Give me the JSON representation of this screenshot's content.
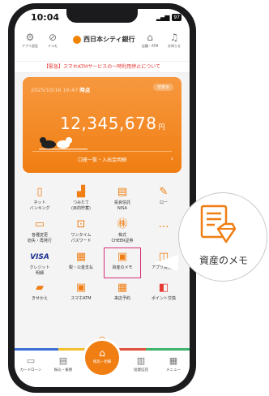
{
  "status": {
    "time": "10:04",
    "battery": "97"
  },
  "header": {
    "left_buttons": [
      {
        "icon": "gear-icon",
        "label": "アプリ設定"
      },
      {
        "icon": "link-icon",
        "label": "ドコモ"
      }
    ],
    "brand": "西日本シティ銀行",
    "right_buttons": [
      {
        "icon": "atm-icon",
        "label": "店舗・ATM"
      },
      {
        "icon": "bell-icon",
        "label": "お知らせ"
      }
    ]
  },
  "alert": "【緊急】スマホATMサービスの一時利用停止について",
  "account": {
    "date": "2025/10/16 16:47",
    "date_suffix": "時点",
    "badge": "非表示",
    "balance": "12,345,678",
    "currency": "円",
    "link": "口座一覧・入出金明細"
  },
  "menu": [
    {
      "icon": "phone-icon",
      "label": "ネット\nバンキング"
    },
    {
      "icon": "chart-icon",
      "label": "つみたて\n(目的貯蓄)"
    },
    {
      "icon": "nisa-icon",
      "label": "投資信託\nNISA"
    },
    {
      "icon": "loan-icon",
      "label": "ロー"
    },
    {
      "icon": "card-icon",
      "label": "各種変更\n紛失・再発行"
    },
    {
      "icon": "lock-icon",
      "label": "ワンタイム\nパスワード"
    },
    {
      "icon": "stock-icon",
      "label": "株式\nCHEER証券"
    },
    {
      "icon": "more-icon",
      "label": ""
    },
    {
      "icon": "visa-icon",
      "label": "クレジット\n明細",
      "glyph": "VISA"
    },
    {
      "icon": "tax-icon",
      "label": "税・公金支払"
    },
    {
      "icon": "memo-icon",
      "label": "資産のメモ"
    },
    {
      "icon": "app-icon",
      "label": "アプリ貸込金"
    },
    {
      "icon": "dress-icon",
      "label": "きせかえ"
    },
    {
      "icon": "atm-icon",
      "label": "スマホATM"
    },
    {
      "icon": "calendar-icon",
      "label": "来店予約"
    },
    {
      "icon": "point-icon",
      "label": "ポイント交換"
    }
  ],
  "tabs": [
    {
      "icon": "card-icon",
      "label": "カードローン"
    },
    {
      "icon": "receipt-icon",
      "label": "振込・振替"
    },
    {
      "icon": "home-icon",
      "label": "残高・明細"
    },
    {
      "icon": "bar-chart-icon",
      "label": "投資信託"
    },
    {
      "icon": "grid-icon",
      "label": "メニュー"
    }
  ],
  "zoom": {
    "label": "資産のメモ"
  },
  "colors": {
    "accent": "#f07e12",
    "highlight": "#d6307a",
    "alert": "#e53935"
  }
}
